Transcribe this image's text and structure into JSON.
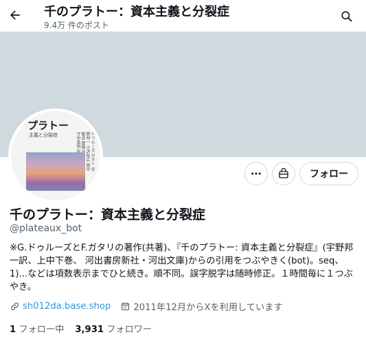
{
  "header": {
    "title": "千のプラトー：資本主義と分裂症",
    "post_count": "9.4万 件のポスト"
  },
  "avatar_book": {
    "title": "プラトー",
    "subtitle": "主義と分裂症",
    "authors": "ドゥルーズ ガタリ 宇野邦一 小沢秋広 田中敏彦 豊崎光一 宮林寛 守中高明 訳"
  },
  "actions": {
    "follow_label": "フォロー"
  },
  "profile": {
    "name": "千のプラトー：資本主義と分裂症",
    "handle": "@plateaux_bot",
    "bio": "※G.ドゥルーズとF.ガタリの著作(共著)、『千のプラトー: 資本主義と分裂症』(宇野邦一訳、上中下巻、 河出書房新社・河出文庫)からの引用をつぶやきく(bot)。seq、1)...などは項数表示までひと続き。順不同。誤字脱字は随時修正。１時間毎に１つぶやき。",
    "website": "sh012da.base.shop",
    "joined": "2011年12月からXを利用しています"
  },
  "stats": {
    "following_count": "1",
    "following_label": "フォロー中",
    "followers_count": "3,931",
    "followers_label": "フォロワー"
  },
  "colors": {
    "banner": "#cfd9de",
    "link": "#1d9bf0",
    "secondary_text": "#536471"
  }
}
